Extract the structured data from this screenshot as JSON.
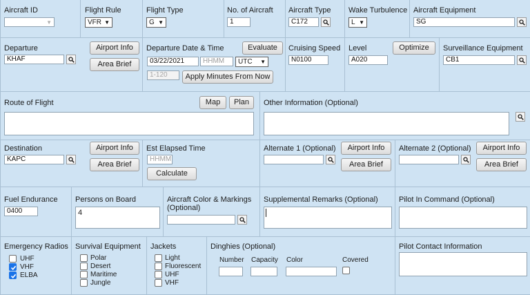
{
  "row1": {
    "aircraft_id": {
      "label": "Aircraft ID",
      "value": ""
    },
    "flight_rule": {
      "label": "Flight Rule",
      "value": "VFR"
    },
    "flight_type": {
      "label": "Flight Type",
      "value": "G"
    },
    "num_aircraft": {
      "label": "No. of Aircraft",
      "value": "1"
    },
    "aircraft_type": {
      "label": "Aircraft Type",
      "value": "C172"
    },
    "wake_turbulence": {
      "label": "Wake Turbulence",
      "value": "L"
    },
    "aircraft_equipment": {
      "label": "Aircraft Equipment",
      "value": "SG"
    }
  },
  "row2": {
    "departure": {
      "label": "Departure",
      "value": "KHAF",
      "airport_info": "Airport Info",
      "area_brief": "Area Brief"
    },
    "departure_datetime": {
      "label": "Departure Date & Time",
      "evaluate": "Evaluate",
      "date": "03/22/2021",
      "time_placeholder": "HHMM",
      "timezone": "UTC",
      "minutes_placeholder": "1-120",
      "apply_minutes": "Apply Minutes From Now"
    },
    "cruising_speed": {
      "label": "Cruising Speed",
      "value": "N0100"
    },
    "level": {
      "label": "Level",
      "value": "A020",
      "optimize": "Optimize"
    },
    "surveillance_equipment": {
      "label": "Surveillance Equipment",
      "value": "CB1"
    }
  },
  "row3": {
    "route": {
      "label": "Route of Flight",
      "map": "Map",
      "plan": "Plan",
      "value": ""
    },
    "other_info": {
      "label": "Other Information (Optional)",
      "value": ""
    }
  },
  "row4": {
    "destination": {
      "label": "Destination",
      "value": "KAPC",
      "airport_info": "Airport Info",
      "area_brief": "Area Brief"
    },
    "est_elapsed": {
      "label": "Est Elapsed Time",
      "placeholder": "HHMM",
      "calculate": "Calculate"
    },
    "alternate1": {
      "label": "Alternate 1 (Optional)",
      "value": "",
      "airport_info": "Airport Info",
      "area_brief": "Area Brief"
    },
    "alternate2": {
      "label": "Alternate 2 (Optional)",
      "value": "",
      "airport_info": "Airport Info",
      "area_brief": "Area Brief"
    }
  },
  "row5": {
    "fuel_endurance": {
      "label": "Fuel Endurance",
      "value": "0400"
    },
    "persons_on_board": {
      "label": "Persons on Board",
      "value": "4"
    },
    "aircraft_color": {
      "label_line1": "Aircraft Color & Markings",
      "label_line2": "(Optional)",
      "value": ""
    },
    "supplemental_remarks": {
      "label": "Supplemental Remarks (Optional)",
      "value": ""
    },
    "pilot_in_command": {
      "label": "Pilot In Command (Optional)",
      "value": ""
    }
  },
  "row6": {
    "emergency_radios": {
      "label": "Emergency Radios",
      "options": [
        {
          "label": "UHF",
          "checked": false
        },
        {
          "label": "VHF",
          "checked": true
        },
        {
          "label": "ELBA",
          "checked": true
        }
      ]
    },
    "survival_equipment": {
      "label": "Survival Equipment",
      "options": [
        {
          "label": "Polar",
          "checked": false
        },
        {
          "label": "Desert",
          "checked": false
        },
        {
          "label": "Maritime",
          "checked": false
        },
        {
          "label": "Jungle",
          "checked": false
        }
      ]
    },
    "jackets": {
      "label": "Jackets",
      "options": [
        {
          "label": "Light",
          "checked": false
        },
        {
          "label": "Fluorescent",
          "checked": false
        },
        {
          "label": "UHF",
          "checked": false
        },
        {
          "label": "VHF",
          "checked": false
        }
      ]
    },
    "dinghies": {
      "label": "Dinghies (Optional)",
      "number": "Number",
      "capacity": "Capacity",
      "color": "Color",
      "covered": "Covered"
    },
    "pilot_contact": {
      "label": "Pilot Contact Information",
      "value": ""
    }
  },
  "icons": {
    "search": "search-icon",
    "checkmark": "checkmark-icon",
    "dropdown": "chevron-down-icon"
  },
  "colors": {
    "panel_bg": "#cfe3f3",
    "border": "#a9c0d3",
    "checkbox_on": "#1a73e8"
  }
}
